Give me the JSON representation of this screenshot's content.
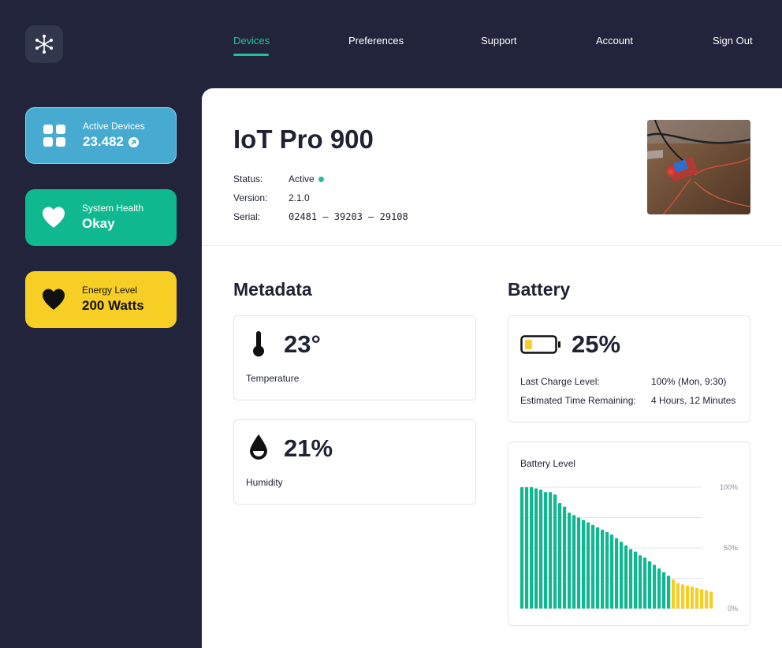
{
  "logo": {
    "icon": "asterisk-logo-icon"
  },
  "nav": {
    "items": [
      {
        "label": "Devices",
        "active": true
      },
      {
        "label": "Preferences",
        "active": false
      },
      {
        "label": "Support",
        "active": false
      },
      {
        "label": "Account",
        "active": false
      },
      {
        "label": "Sign Out",
        "active": false
      }
    ]
  },
  "sidebar": {
    "cards": [
      {
        "label": "Active Devices",
        "value": "23.482",
        "icon": "grid-icon",
        "color": "#47abd1"
      },
      {
        "label": "System Health",
        "value": "Okay",
        "icon": "heart-icon",
        "color": "#10b890"
      },
      {
        "label": "Energy Level",
        "value": "200 Watts",
        "icon": "heart-icon",
        "color": "#f7ce23"
      }
    ]
  },
  "device": {
    "title": "IoT Pro 900",
    "status_label": "Status:",
    "status_value": "Active",
    "version_label": "Version:",
    "version_value": "2.1.0",
    "serial_label": "Serial:",
    "serial_value": "02481 — 39203 — 29108"
  },
  "metadata": {
    "title": "Metadata",
    "temperature": {
      "value": "23°",
      "label": "Temperature",
      "icon": "thermometer-icon"
    },
    "humidity": {
      "value": "21%",
      "label": "Humidity",
      "icon": "droplet-icon"
    }
  },
  "battery": {
    "title": "Battery",
    "percent": "25%",
    "level": 0.25,
    "icon": "battery-icon",
    "last_charge_label": "Last Charge Level:",
    "last_charge_value": "100% (Mon, 9:30)",
    "remaining_label": "Estimated Time Remaining:",
    "remaining_value": "4 Hours, 12 Minutes"
  },
  "chart_data": {
    "type": "bar",
    "title": "Battery Level",
    "ylim": [
      0,
      100
    ],
    "ytick_labels": [
      "100%",
      "50%",
      "0%"
    ],
    "grid": true,
    "values": [
      100,
      100,
      100,
      99,
      98,
      96,
      96,
      94,
      87,
      84,
      79,
      77,
      75,
      73,
      71,
      69,
      67,
      65,
      63,
      61,
      58,
      55,
      52,
      49,
      47,
      44,
      42,
      39,
      36,
      33,
      30,
      27,
      24,
      21,
      20,
      19,
      18,
      17,
      16,
      15,
      14
    ],
    "colors": {
      "normal": "#10b890",
      "low": "#f7ce23"
    },
    "low_threshold": 25
  }
}
